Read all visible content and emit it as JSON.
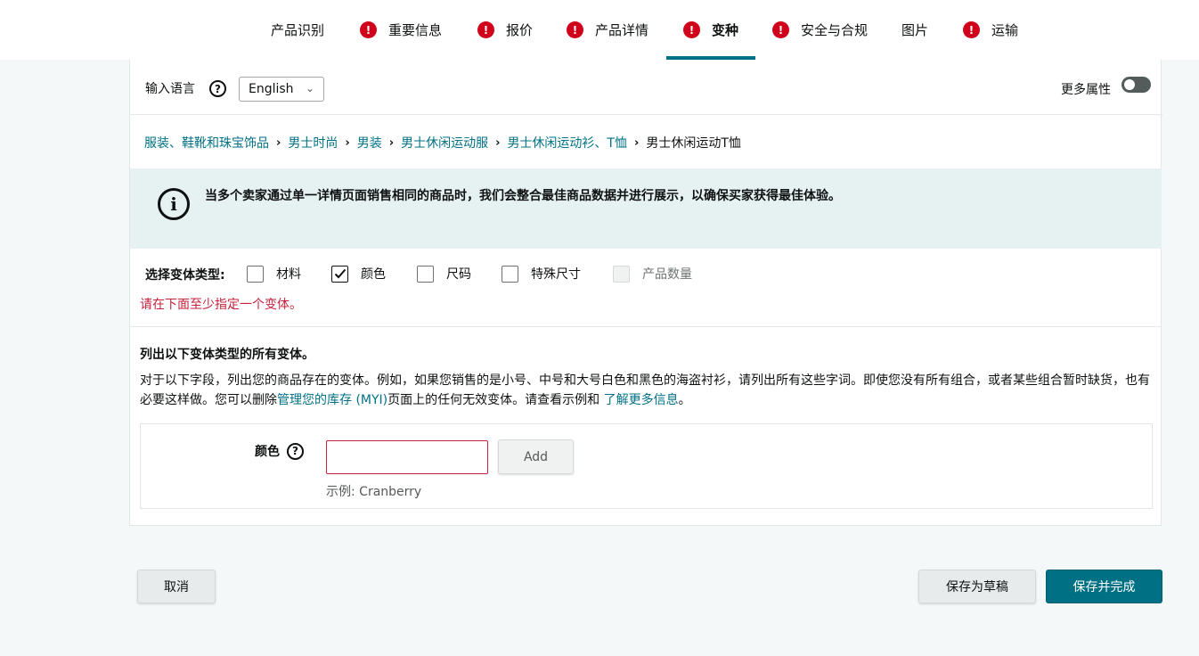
{
  "tabs": {
    "items": [
      {
        "label": "产品识别",
        "alert": false
      },
      {
        "label": "重要信息",
        "alert": true
      },
      {
        "label": "报价",
        "alert": true
      },
      {
        "label": "产品详情",
        "alert": true
      },
      {
        "label": "变种",
        "alert": true,
        "active": true
      },
      {
        "label": "安全与合规",
        "alert": true
      },
      {
        "label": "图片",
        "alert": false
      },
      {
        "label": "运输",
        "alert": true
      }
    ],
    "alert_glyph": "!"
  },
  "language": {
    "label": "输入语言",
    "help_glyph": "?",
    "selected": "English",
    "chevron": "⌄"
  },
  "more_attributes": {
    "label": "更多属性",
    "enabled": false
  },
  "breadcrumb": {
    "links": [
      "服装、鞋靴和珠宝饰品",
      "男士时尚",
      "男装",
      "男士休闲运动服",
      "男士休闲运动衫、T恤"
    ],
    "current": "男士休闲运动T恤",
    "separator": "›"
  },
  "info": {
    "icon_glyph": "i",
    "text": "当多个卖家通过单一详情页面销售相同的商品时，我们会整合最佳商品数据并进行展示，以确保买家获得最佳体验。"
  },
  "variation_type": {
    "label": "选择变体类型:",
    "options": [
      {
        "label": "材料",
        "checked": false,
        "disabled": false
      },
      {
        "label": "颜色",
        "checked": true,
        "disabled": false
      },
      {
        "label": "尺码",
        "checked": false,
        "disabled": false
      },
      {
        "label": "特殊尺寸",
        "checked": false,
        "disabled": false
      },
      {
        "label": "产品数量",
        "checked": false,
        "disabled": true
      }
    ],
    "error": "请在下面至少指定一个变体。"
  },
  "variants": {
    "heading": "列出以下变体类型的所有变体。",
    "desc_part1": "对于以下字段，列出您的商品存在的变体。例如，如果您销售的是小号、中号和大号白色和黑色的海盗衬衫，请列出所有这些字词。即使您没有所有组合，或者某些组合暂时缺货，也有必要这样做。您可以删除",
    "desc_link1": "管理您的库存 (MYI)",
    "desc_part2": "页面上的任何无效变体。请查看示例和 ",
    "desc_link2": "了解更多信息",
    "desc_part3": "。",
    "color_label": "颜色",
    "color_value": "",
    "add_label": "Add",
    "example": "示例:   Cranberry"
  },
  "footer": {
    "cancel_label": "取消",
    "draft_label": "保存为草稿",
    "finish_label": "保存并完成"
  },
  "colors": {
    "accent": "#007185",
    "alert": "#d0021b",
    "error": "#c7213d",
    "info_bg": "#e6f1f2"
  }
}
